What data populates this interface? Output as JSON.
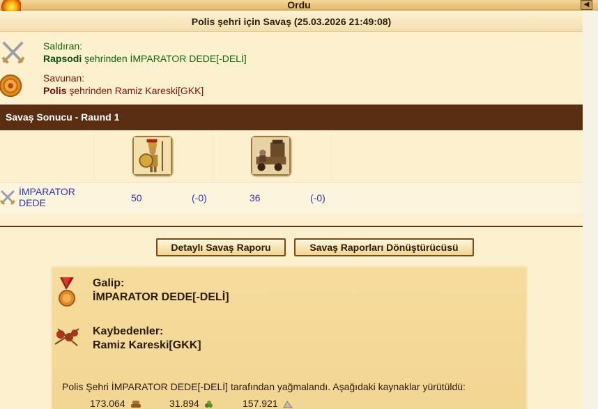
{
  "window": {
    "title": "Ordu",
    "back_icon": "back-arrow-icon"
  },
  "report": {
    "title": "Polis şehri için Savaş (25.03.2026 21:49:08)",
    "attacker": {
      "role": "Saldıran:",
      "city": "Rapsodi",
      "rest": " şehrinden İMPARATOR DEDE[-DELİ]",
      "icon": "crossed-swords-icon"
    },
    "defender": {
      "role": "Savunan:",
      "city": "Polis",
      "rest": " şehrinden Ramiz Kareski[GKK]",
      "icon": "shield-icon"
    }
  },
  "round": {
    "title": "Savaş Sonucu - Raund 1",
    "units": [
      {
        "icon": "hoplite-unit-icon"
      },
      {
        "icon": "siege-ram-unit-icon"
      }
    ],
    "player": {
      "name_line1": "İMPARATOR",
      "name_line2": "DEDE"
    },
    "counts": [
      {
        "count": "50",
        "loss": "(-0)"
      },
      {
        "count": "36",
        "loss": "(-0)"
      }
    ]
  },
  "buttons": {
    "detailed_report": "Detaylı Savaş Raporu",
    "converter": "Savaş Raporları Dönüştürücüsü"
  },
  "result": {
    "winner_label": "Galip:",
    "winner_name": "İMPARATOR DEDE[-DELİ]",
    "loser_label": "Kaybedenler:",
    "loser_name": "Ramiz Kareski[GKK]",
    "loot_text": "Polis Şehri İMPARATOR DEDE[-DELİ] tarafından yağmalandı. Aşağıdaki kaynaklar yürütüldü:",
    "resources": [
      {
        "value": "173.064",
        "icon": "wood-icon"
      },
      {
        "value": "31.894",
        "icon": "wine-icon"
      },
      {
        "value": "157.921",
        "icon": "marble-icon"
      }
    ]
  },
  "colors": {
    "round_bar": "#5a2e12",
    "attacker_text": "#0d6a0d",
    "defender_text": "#7a1010",
    "link_blue": "#2d35b5"
  }
}
